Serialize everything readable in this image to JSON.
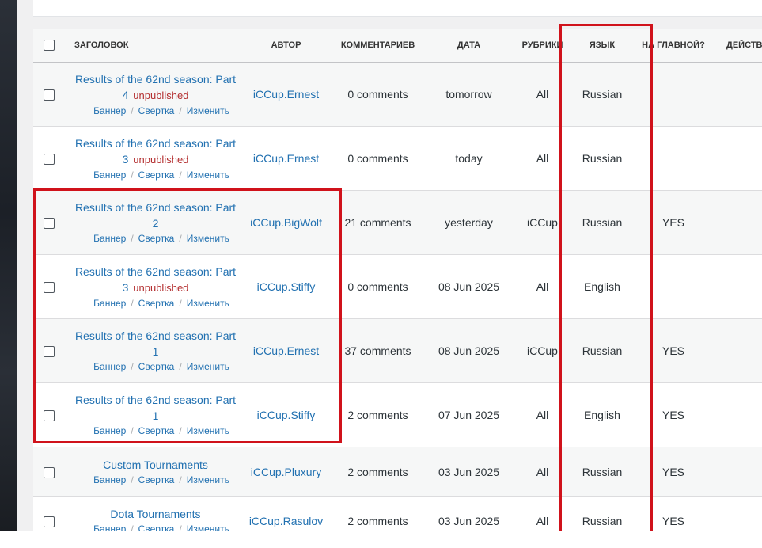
{
  "table": {
    "headers": {
      "title": "Заголовок",
      "author": "Автор",
      "comments": "Комментариев",
      "date": "Дата",
      "category": "Рубрики",
      "language": "Язык",
      "featured": "На главной?",
      "actions": "Действ"
    },
    "row_actions": {
      "banner": "Баннер",
      "collapse": "Свертка",
      "edit": "Изменить",
      "separator": "/"
    },
    "rows": [
      {
        "title": "Results of the 62nd season: Part 4",
        "state": "unpublished",
        "author": "iCCup.Ernest",
        "comments": "0 comments",
        "date": "tomorrow",
        "category": "All",
        "language": "Russian",
        "featured": ""
      },
      {
        "title": "Results of the 62nd season: Part 3",
        "state": "unpublished",
        "author": "iCCup.Ernest",
        "comments": "0 comments",
        "date": "today",
        "category": "All",
        "language": "Russian",
        "featured": ""
      },
      {
        "title": "Results of the 62nd season: Part 2",
        "state": "",
        "author": "iCCup.BigWolf",
        "comments": "21 comments",
        "date": "yesterday",
        "category": "iCCup",
        "language": "Russian",
        "featured": "YES"
      },
      {
        "title": "Results of the 62nd season: Part 3",
        "state": "unpublished",
        "author": "iCCup.Stiffy",
        "comments": "0 comments",
        "date": "08 Jun 2025",
        "category": "All",
        "language": "English",
        "featured": ""
      },
      {
        "title": "Results of the 62nd season: Part 1",
        "state": "",
        "author": "iCCup.Ernest",
        "comments": "37 comments",
        "date": "08 Jun 2025",
        "category": "iCCup",
        "language": "Russian",
        "featured": "YES"
      },
      {
        "title": "Results of the 62nd season: Part 1",
        "state": "",
        "author": "iCCup.Stiffy",
        "comments": "2 comments",
        "date": "07 Jun 2025",
        "category": "All",
        "language": "English",
        "featured": "YES"
      },
      {
        "title": "Custom Tournaments",
        "state": "",
        "author": "iCCup.Pluxury",
        "comments": "2 comments",
        "date": "03 Jun 2025",
        "category": "All",
        "language": "Russian",
        "featured": "YES"
      },
      {
        "title": "Dota Tournaments",
        "state": "",
        "author": "iCCup.Rasulov",
        "comments": "2 comments",
        "date": "03 Jun 2025",
        "category": "All",
        "language": "Russian",
        "featured": "YES"
      }
    ]
  },
  "highlight_color": "#d0121b"
}
